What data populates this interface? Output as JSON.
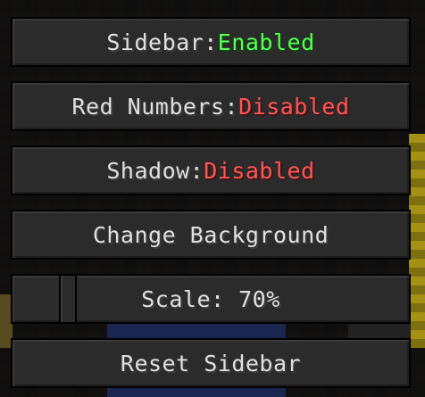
{
  "menu": {
    "sidebar": {
      "label": "Sidebar: ",
      "value": "Enabled",
      "value_color": "#55ff55"
    },
    "red_numbers": {
      "label": "Red Numbers: ",
      "value": "Disabled",
      "value_color": "#ff5555"
    },
    "shadow": {
      "label": "Shadow: ",
      "value": "Disabled",
      "value_color": "#ff5555"
    },
    "change_background": {
      "label": "Change Background"
    },
    "scale": {
      "label": "Scale: 70%",
      "value_percent": 70
    },
    "reset_sidebar": {
      "label": "Reset Sidebar"
    }
  }
}
